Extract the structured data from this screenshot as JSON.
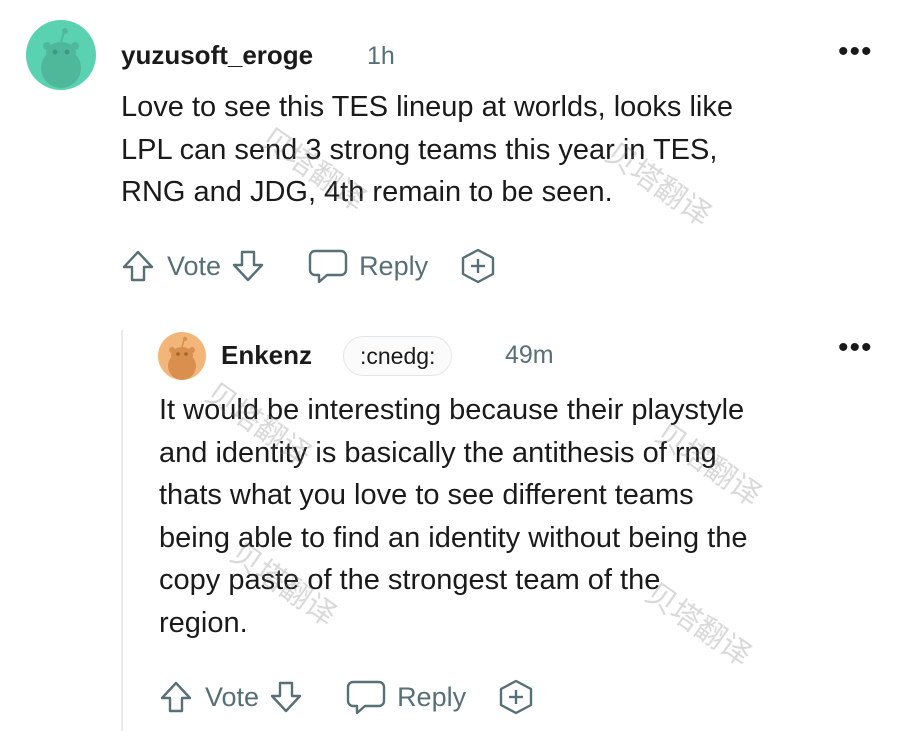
{
  "comment": {
    "username": "yuzusoft_eroge",
    "time": "1h",
    "more": "•••",
    "avatar_color": "#5ad2b2",
    "lines": [
      "Love to see this TES lineup at worlds, looks like",
      "LPL can send 3 strong teams this year in TES,",
      "RNG and JDG, 4th remain to be seen."
    ],
    "actions": {
      "vote": "Vote",
      "reply": "Reply"
    }
  },
  "reply": {
    "username": "Enkenz",
    "flair": ":cnedg:",
    "time": "49m",
    "more": "•••",
    "avatar_color": "#f3b67a",
    "lines": [
      "It would be interesting because their playstyle",
      "and identity is basically the antithesis of rng",
      "thats what you love to see different teams",
      "being able to find an identity without being the",
      "copy paste of the strongest team of the",
      "region."
    ],
    "actions": {
      "vote": "Vote",
      "reply": "Reply"
    }
  },
  "watermark": "贝塔翻译",
  "icons": [
    "upvote-icon",
    "downvote-icon",
    "reply-icon",
    "award-icon",
    "more-icon"
  ]
}
